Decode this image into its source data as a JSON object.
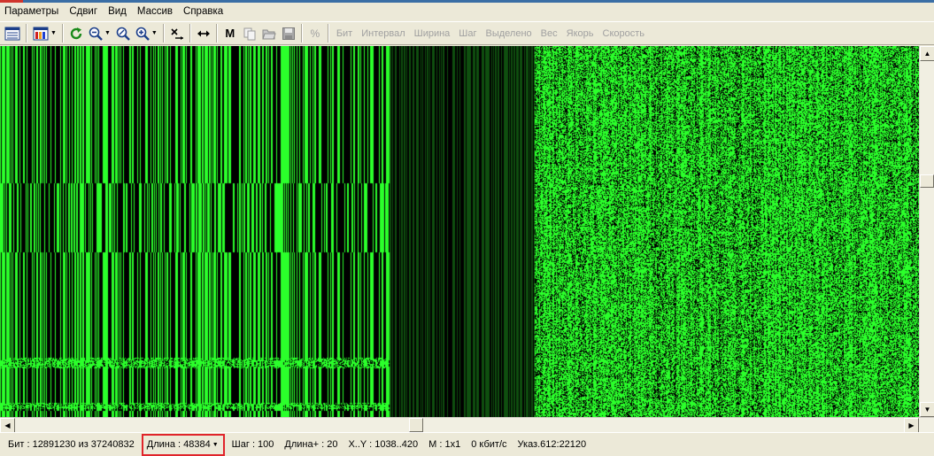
{
  "menu": {
    "items": [
      "Параметры",
      "Сдвиг",
      "Вид",
      "Массив",
      "Справка"
    ]
  },
  "toolbar": {
    "icons": {
      "view_text": "text-view-icon",
      "palette": "palette-icon",
      "refresh": "refresh-icon",
      "zoom_out": "zoom-out-icon",
      "zoom_fit": "zoom-fit-icon",
      "zoom_in": "zoom-in-icon",
      "shift": "shift-icon",
      "width": "width-icon",
      "copy": "copy-icon",
      "open": "open-icon",
      "save": "save-icon"
    },
    "m_label": "M",
    "percent_label": "%",
    "params": [
      "Бит",
      "Интервал",
      "Ширина",
      "Шаг",
      "Выделено",
      "Вес",
      "Якорь",
      "Скорость"
    ]
  },
  "colors": {
    "canvas_green": "#2bff2b",
    "canvas_dark_green": "#0f4f0f",
    "canvas_black": "#000000",
    "length_highlight": "#e0242b"
  },
  "statusbar": {
    "bit": "Бит : 12891230 из 37240832",
    "length": "Длина : 48384",
    "step": "Шаг : 100",
    "length_plus": "Длина+ : 20",
    "xy": "X..Y : 1038..420",
    "m": "М : 1x1",
    "speed": "0 кбит/с",
    "pointer": "Указ.612:22120"
  }
}
